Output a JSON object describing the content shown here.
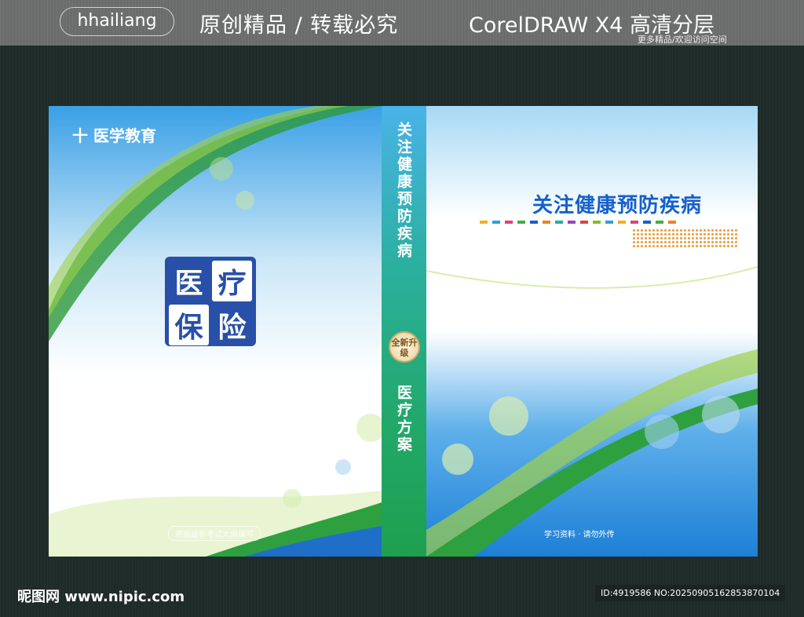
{
  "banner": {
    "author": "hhailiang",
    "slogan": "原创精品 / 转载必究",
    "software": "CorelDRAW X4  高清分层",
    "sub": "更多精品/欢迎访问空间"
  },
  "left_cover": {
    "logo": "十 医学教育",
    "seal": [
      "医",
      "疗",
      "保",
      "险"
    ],
    "motto": "依据最新考试大纲编写"
  },
  "spine": {
    "title": "关注健康预防疾病",
    "badge": "全新升级",
    "subtitle": "医疗方案"
  },
  "right_cover": {
    "title": "关注健康预防疾病",
    "note": "学习资料 · 请勿外传",
    "dot_colors": [
      "#f0b020",
      "#2aa0e0",
      "#e04080",
      "#40b040",
      "#1560cc",
      "#f08020",
      "#20b0a0",
      "#a040c0",
      "#e04040",
      "#80c020",
      "#2aa0e0",
      "#f0b020",
      "#e04080",
      "#1560cc",
      "#40b040",
      "#f08020"
    ]
  },
  "footer": {
    "site": "昵图网 www.nipic.com",
    "id": "ID:4919586 NO:20250905162853870104"
  }
}
